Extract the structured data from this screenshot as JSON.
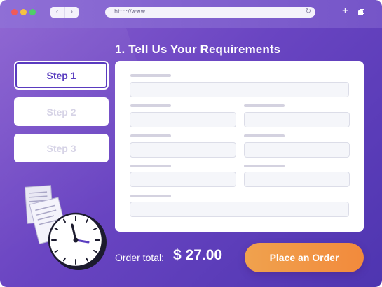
{
  "browser": {
    "url": "http://www",
    "back_glyph": "‹",
    "forward_glyph": "›",
    "reload_glyph": "↻",
    "new_tab_glyph": "+",
    "icons": [
      "back-icon",
      "forward-icon",
      "reload-icon",
      "plus-icon",
      "tabs-icon"
    ]
  },
  "form": {
    "title": "1. Tell Us Your Requirements",
    "steps": [
      {
        "label": "Step 1",
        "active": true
      },
      {
        "label": "Step 2",
        "active": false
      },
      {
        "label": "Step 3",
        "active": false
      }
    ]
  },
  "footer": {
    "total_label": "Order total:",
    "total_amount": "$ 27.00",
    "order_button": "Place an Order"
  },
  "colors": {
    "accent": "#5b3fc0",
    "button_orange": "#f28a3c",
    "background_purple": "#6a45c2"
  }
}
